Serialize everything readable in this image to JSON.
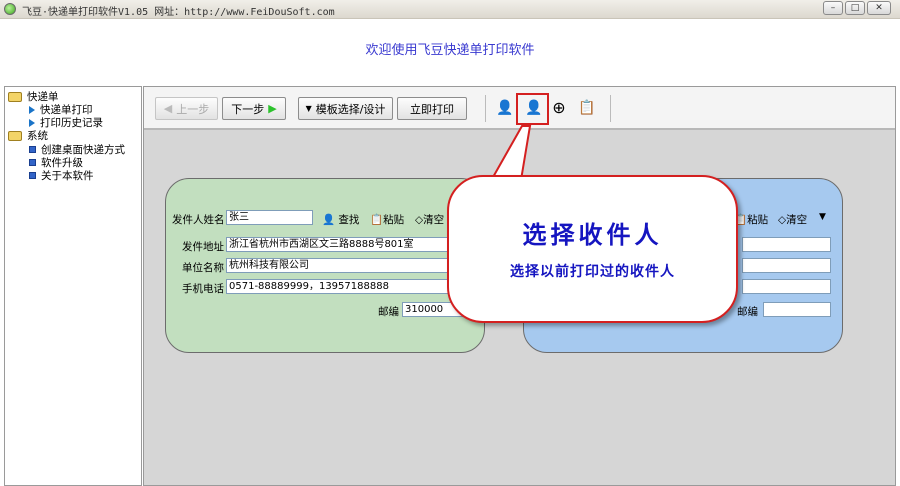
{
  "window": {
    "title": "飞豆·快递单打印软件V1.05  网址：http://www.FeiDouSoft.com",
    "min": "–",
    "max": "□",
    "close": "✕"
  },
  "header": {
    "title": "欢迎使用飞豆快递单打印软件"
  },
  "sidebar": {
    "groups": [
      {
        "label": "快递单",
        "items": [
          "快递单打印",
          "打印历史记录"
        ]
      },
      {
        "label": "系统",
        "items": [
          "创建桌面快递方式",
          "软件升级",
          "关于本软件"
        ]
      }
    ]
  },
  "toolbar": {
    "prev": "上一步",
    "next": "下一步",
    "template": "模板选择/设计",
    "print": "立即打印"
  },
  "sender": {
    "name_label": "发件人姓名",
    "name": "张三",
    "find": "查找",
    "paste": "粘贴",
    "clear": "清空",
    "address_label": "发件地址",
    "address": "浙江省杭州市西湖区文三路8888号801室",
    "company_label": "单位名称",
    "company": "杭州科技有限公司",
    "phone_label": "手机电话",
    "phone": "0571-88889999，13957188888",
    "postcode_label": "邮编",
    "postcode": "310000"
  },
  "receiver": {
    "paste": "粘贴",
    "clear": "清空",
    "postcode_label": "邮编",
    "postcode": ""
  },
  "callout": {
    "title": "选择收件人",
    "subtitle": "选择以前打印过的收件人"
  }
}
